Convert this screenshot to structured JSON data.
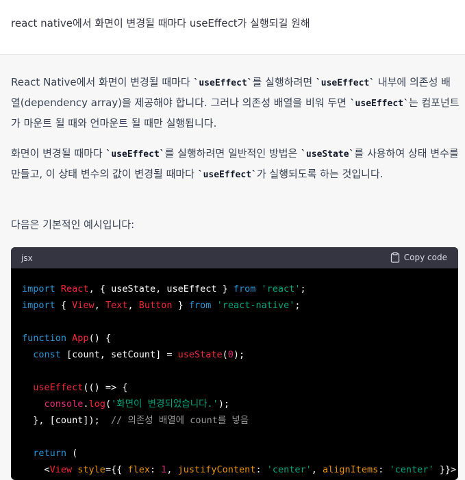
{
  "user_message": "react native에서 화면이 변경될 때마다 useEffect가 실행되길 원해",
  "answer": {
    "p1": {
      "a": "React Native에서 화면이 변경될 때마다 ",
      "c1": "`useEffect`",
      "b": "를 실행하려면 ",
      "c2": "`useEffect`",
      "c": " 내부에 의존성 배열(dependency array)을 제공해야 합니다. 그러나 의존성 배열을 비워 두면 ",
      "c3": "`useEffect`",
      "d": "는 컴포넌트가 마운트 될 때와 언마운트 될 때만 실행됩니다."
    },
    "p2": {
      "a": "화면이 변경될 때마다 ",
      "c1": "`useEffect`",
      "b": "를 실행하려면 일반적인 방법은 ",
      "c2": "`useState`",
      "c": "를 사용하여 상태 변수를 만들고, 이 상태 변수의 값이 변경될 때마다 ",
      "c3": "`useEffect`",
      "d": "가 실행되도록 하는 것입니다."
    },
    "p3": "다음은 기본적인 예시입니다:"
  },
  "code_block": {
    "language": "jsx",
    "copy_label": "Copy code"
  }
}
